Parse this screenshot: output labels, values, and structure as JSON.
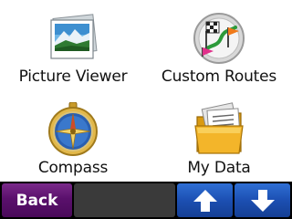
{
  "menu": {
    "items": [
      {
        "label": "Picture Viewer",
        "icon": "picture-viewer-icon"
      },
      {
        "label": "Custom Routes",
        "icon": "custom-routes-icon"
      },
      {
        "label": "Compass",
        "icon": "compass-icon"
      },
      {
        "label": "My Data",
        "icon": "folder-icon"
      }
    ]
  },
  "toolbar": {
    "back_label": "Back",
    "up_icon": "arrow-up-icon",
    "down_icon": "arrow-down-icon"
  },
  "colors": {
    "back_button": "#5a106c",
    "arrow_button": "#1c4fb2",
    "bar_background": "#000000",
    "empty_slot": "#3a3a3a"
  }
}
